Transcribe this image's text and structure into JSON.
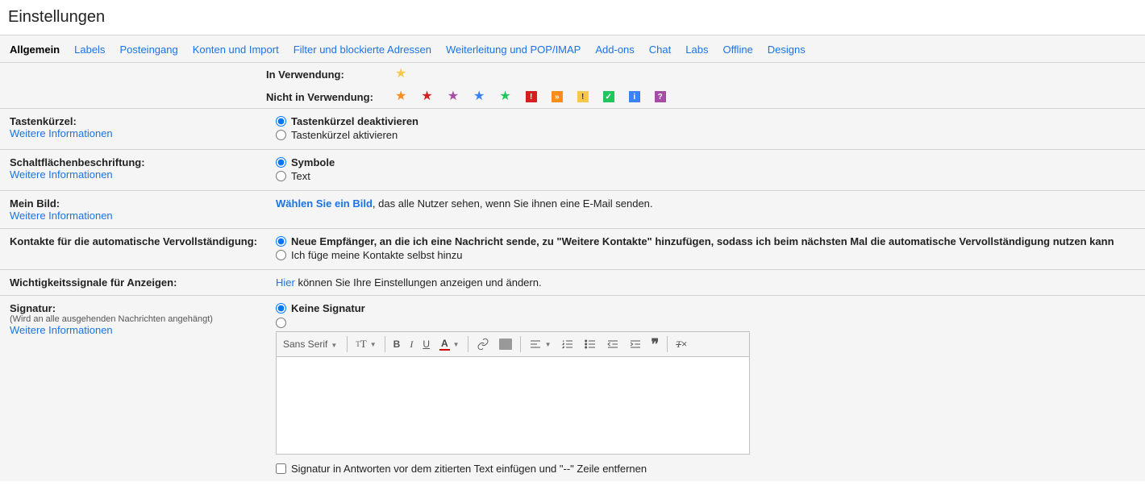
{
  "page_title": "Einstellungen",
  "tabs": [
    "Allgemein",
    "Labels",
    "Posteingang",
    "Konten und Import",
    "Filter und blockierte Adressen",
    "Weiterleitung und POP/IMAP",
    "Add-ons",
    "Chat",
    "Labs",
    "Offline",
    "Designs"
  ],
  "stars": {
    "in_use_label": "In Verwendung:",
    "not_in_use_label": "Nicht in Verwendung:"
  },
  "shortcuts": {
    "title": "Tastenkürzel:",
    "learn_more": "Weitere Informationen",
    "opt_off": "Tastenkürzel deaktivieren",
    "opt_on": "Tastenkürzel aktivieren"
  },
  "button_labels": {
    "title": "Schaltflächenbeschriftung:",
    "learn_more": "Weitere Informationen",
    "opt_icons": "Symbole",
    "opt_text": "Text"
  },
  "picture": {
    "title": "Mein Bild:",
    "learn_more": "Weitere Informationen",
    "link": "Wählen Sie ein Bild",
    "rest": ", das alle Nutzer sehen, wenn Sie ihnen eine E-Mail senden."
  },
  "contacts": {
    "title": "Kontakte für die automatische Vervollständigung:",
    "opt_auto": "Neue Empfänger, an die ich eine Nachricht sende, zu \"Weitere Kontakte\" hinzufügen, sodass ich beim nächsten Mal die automatische Vervollständigung nutzen kann",
    "opt_manual": "Ich füge meine Kontakte selbst hinzu"
  },
  "importance": {
    "title": "Wichtigkeitssignale für Anzeigen:",
    "link": "Hier",
    "rest": " können Sie Ihre Einstellungen anzeigen und ändern."
  },
  "signature": {
    "title": "Signatur:",
    "sublabel": "(Wird an alle ausgehenden Nachrichten angehängt)",
    "learn_more": "Weitere Informationen",
    "opt_none": "Keine Signatur",
    "font_name": "Sans Serif",
    "checkbox_label": "Signatur in Antworten vor dem zitierten Text einfügen und \"--\" Zeile entfernen"
  }
}
